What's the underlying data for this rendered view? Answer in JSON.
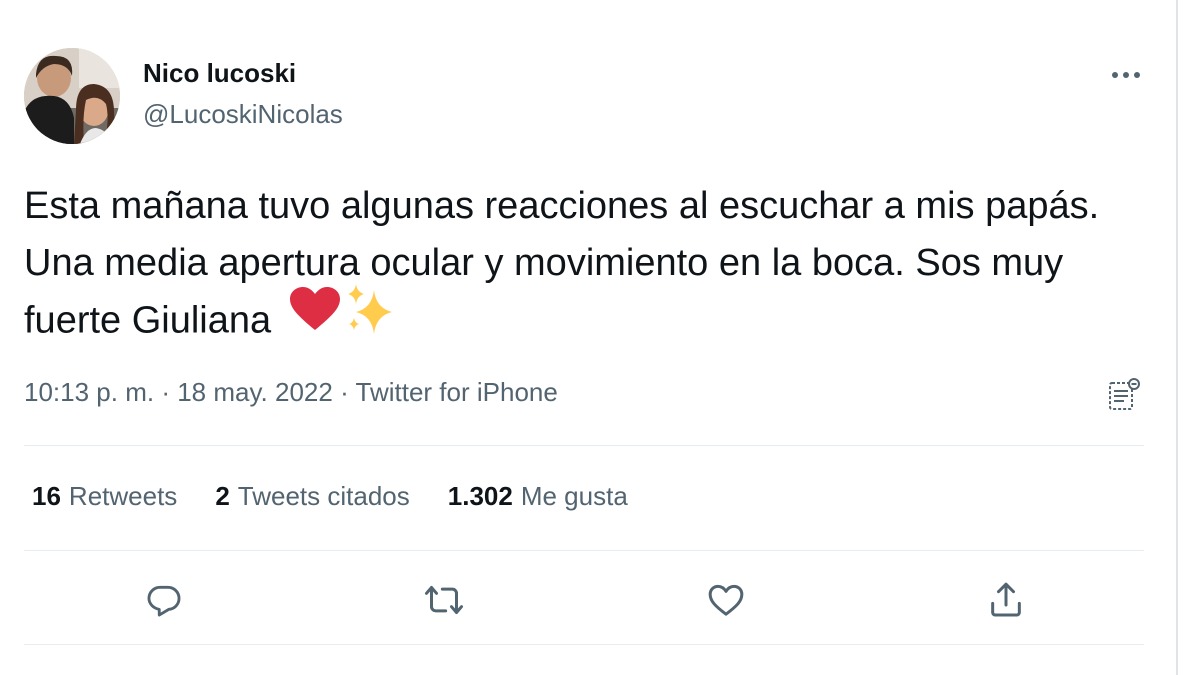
{
  "author": {
    "display_name": "Nico lucoski",
    "handle": "@LucoskiNicolas"
  },
  "tweet": {
    "text": "Esta mañana tuvo algunas reacciones al escuchar a mis papás. Una media apertura ocular y movimiento en la boca. Sos muy fuerte Giuliana",
    "emojis": [
      "red-heart",
      "sparkles"
    ]
  },
  "meta": {
    "time": "10:13 p. m.",
    "separator": "·",
    "date": "18 may. 2022",
    "source": "Twitter for iPhone"
  },
  "stats": {
    "retweets_count": "16",
    "retweets_label": "Retweets",
    "quotes_count": "2",
    "quotes_label": "Tweets citados",
    "likes_count": "1.302",
    "likes_label": "Me gusta"
  },
  "actions": [
    "reply-icon",
    "retweet-icon",
    "like-icon",
    "share-icon"
  ],
  "colors": {
    "text_primary": "#0f1419",
    "text_secondary": "#536471",
    "divider": "#e6ecf0",
    "heart": "#dd2e44",
    "sparkle": "#ffcc4d"
  }
}
